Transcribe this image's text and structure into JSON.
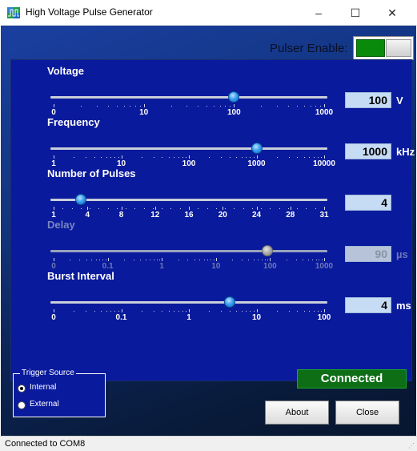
{
  "window": {
    "title": "High Voltage Pulse Generator",
    "app_icon": "generator-icon"
  },
  "window_controls": {
    "minimize": "–",
    "maximize": "☐",
    "close": "✕"
  },
  "pulser": {
    "label": "Pulser Enable:",
    "enabled": true,
    "on_color": "#0a8a0a"
  },
  "controls": [
    {
      "id": "voltage",
      "label": "Voltage",
      "enabled": true,
      "scale": "log",
      "min": 0,
      "max": 1000,
      "slider_value": 100,
      "value": "100",
      "unit": "V",
      "major_ticks": [
        "0",
        "10",
        "100",
        "1000"
      ]
    },
    {
      "id": "frequency",
      "label": "Frequency",
      "enabled": true,
      "scale": "log",
      "min": 1,
      "max": 10000,
      "slider_value": 1000,
      "value": "1000",
      "unit": "kHz",
      "major_ticks": [
        "1",
        "10",
        "100",
        "1000",
        "10000"
      ]
    },
    {
      "id": "number-of-pulses",
      "label": "Number of Pulses",
      "enabled": true,
      "scale": "linear",
      "min": 1,
      "max": 31,
      "slider_value": 4,
      "value": "4",
      "unit": "",
      "major_ticks": [
        "1",
        "4",
        "8",
        "12",
        "16",
        "20",
        "24",
        "28",
        "31"
      ]
    },
    {
      "id": "delay",
      "label": "Delay",
      "enabled": false,
      "scale": "log",
      "min": 0,
      "max": 1000,
      "slider_value": 90,
      "value": "90",
      "unit": "µs",
      "major_ticks": [
        "0",
        "0.1",
        "1",
        "10",
        "100",
        "1000"
      ]
    },
    {
      "id": "burst-interval",
      "label": "Burst Interval",
      "enabled": true,
      "scale": "log",
      "min": 0,
      "max": 100,
      "slider_value": 4,
      "value": "4",
      "unit": "ms",
      "major_ticks": [
        "0",
        "0.1",
        "1",
        "10",
        "100"
      ]
    }
  ],
  "trigger": {
    "legend": "Trigger Source",
    "options": [
      "Internal",
      "External"
    ],
    "selected": "Internal"
  },
  "connection_status": "Connected",
  "buttons": {
    "about": "About",
    "close": "Close"
  },
  "statusbar": "Connected  to COM8",
  "colors": {
    "panel": "#0a1a9c",
    "value_box": "#c6dcf5",
    "status_ok": "#0d6e16"
  }
}
